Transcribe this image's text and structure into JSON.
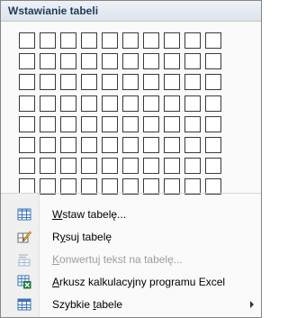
{
  "header": {
    "title": "Wstawianie tabeli"
  },
  "grid": {
    "rows": 8,
    "cols": 10
  },
  "menu": {
    "items": [
      {
        "mnemonic": "W",
        "rest": "staw tabelę...",
        "icon": "insert-table-icon",
        "enabled": true,
        "submenu": false
      },
      {
        "before": "R",
        "mnemonic": "y",
        "rest": "suj tabelę",
        "icon": "draw-table-icon",
        "enabled": true,
        "submenu": false
      },
      {
        "mnemonic": "K",
        "rest": "onwertuj tekst na tabelę...",
        "icon": "convert-text-to-table-icon",
        "enabled": false,
        "submenu": false
      },
      {
        "mnemonic": "A",
        "rest": "rkusz kalkulacyjny programu Excel",
        "icon": "excel-spreadsheet-icon",
        "enabled": true,
        "submenu": false
      },
      {
        "before": "Szybkie ",
        "mnemonic": "t",
        "rest": "abele",
        "icon": "quick-tables-icon",
        "enabled": true,
        "submenu": true
      }
    ]
  }
}
